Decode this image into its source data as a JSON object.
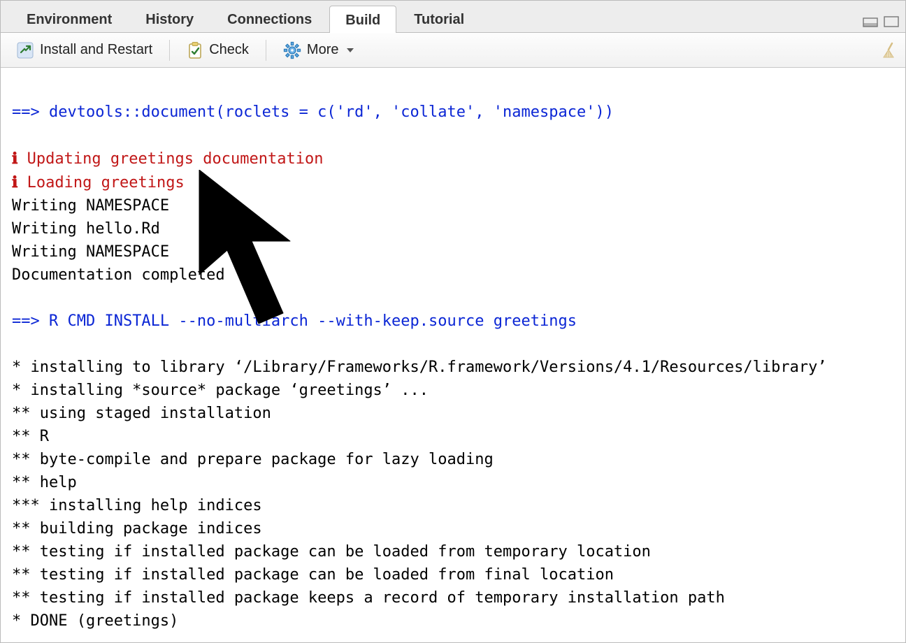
{
  "tabs": [
    {
      "label": "Environment",
      "active": false
    },
    {
      "label": "History",
      "active": false
    },
    {
      "label": "Connections",
      "active": false
    },
    {
      "label": "Build",
      "active": true
    },
    {
      "label": "Tutorial",
      "active": false
    }
  ],
  "toolbar": {
    "install_restart": "Install and Restart",
    "check": "Check",
    "more": "More"
  },
  "console": {
    "cmd1_prefix": "==> ",
    "cmd1_text": "devtools::document(roclets = c('rd', 'collate', 'namespace'))",
    "info1": "Updating greetings documentation",
    "info2": "Loading greetings",
    "line1": "Writing NAMESPACE",
    "line2": "Writing hello.Rd",
    "line3": "Writing NAMESPACE",
    "line4": "Documentation completed",
    "cmd2_prefix": "==> ",
    "cmd2_text": "R CMD INSTALL --no-multiarch --with-keep.source greetings",
    "out1": "* installing to library ‘/Library/Frameworks/R.framework/Versions/4.1/Resources/library’",
    "out2": "* installing *source* package ‘greetings’ ...",
    "out3": "** using staged installation",
    "out4": "** R",
    "out5": "** byte-compile and prepare package for lazy loading",
    "out6": "** help",
    "out7": "*** installing help indices",
    "out8": "** building package indices",
    "out9": "** testing if installed package can be loaded from temporary location",
    "out10": "** testing if installed package can be loaded from final location",
    "out11": "** testing if installed package keeps a record of temporary installation path",
    "out12": "* DONE (greetings)"
  }
}
